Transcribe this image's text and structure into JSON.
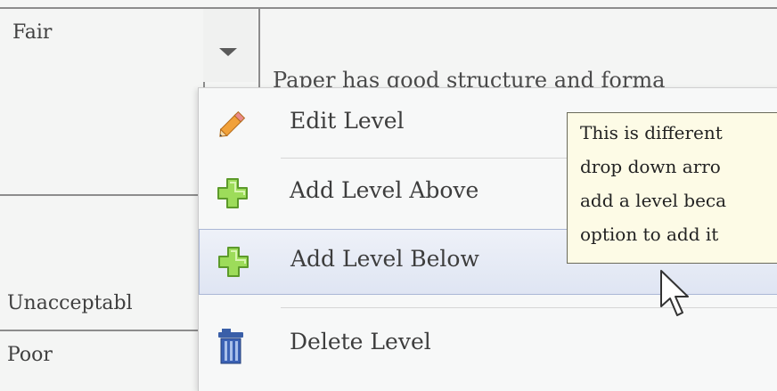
{
  "table": {
    "row1_level": "Fair",
    "row2_level": "Unacceptabl",
    "row3_level": "Poor",
    "description_fragment": "Paper has good structure and forma"
  },
  "context_menu": {
    "items": [
      {
        "label": "Edit Level",
        "icon": "pencil-icon"
      },
      {
        "label": "Add Level Above",
        "icon": "green-plus-icon"
      },
      {
        "label": "Add Level Below",
        "icon": "green-plus-icon"
      },
      {
        "label": "Delete Level",
        "icon": "trash-icon"
      }
    ],
    "highlighted_index": 2
  },
  "tooltip": {
    "lines": [
      "This is different",
      "drop down arro",
      "add a level beca",
      "option to add it"
    ]
  },
  "colors": {
    "highlight": "#dfe5f3",
    "tooltip_bg": "#fdfbe6",
    "plus_green": "#8cd34a"
  }
}
